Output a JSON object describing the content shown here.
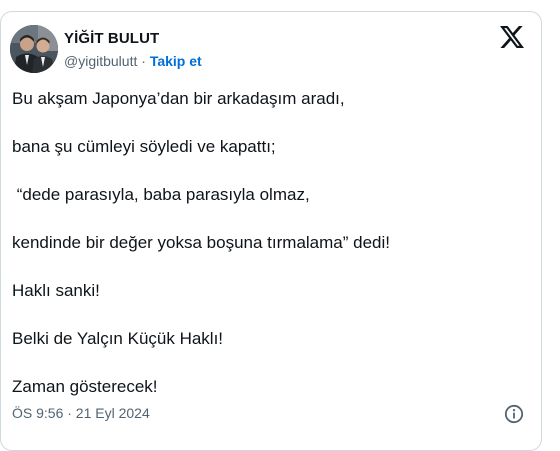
{
  "tweet": {
    "author": {
      "name": "YİĞİT BULUT",
      "handle": "@yigitbulutt",
      "separator": "·",
      "follow_label": "Takip et",
      "avatar_icon": "profile-photo"
    },
    "platform_icon": "x-logo-icon",
    "lines": [
      "Bu akşam Japonya’dan bir arkadaşım aradı,",
      "bana şu cümleyi söyledi ve kapattı;",
      " “dede parasıyla, baba parasıyla olmaz,",
      "kendinde bir değer yoksa boşuna tırmalama” dedi!",
      "Haklı sanki!",
      "Belki de Yalçın Küçük Haklı!",
      "Zaman gösterecek!"
    ],
    "timestamp": "ÖS 9:56 · 21 Eyl 2024",
    "info_icon": "info-circle-icon"
  },
  "colors": {
    "text": "#0f1419",
    "secondary": "#536471",
    "link": "#006fd6",
    "border": "#cfd9de"
  }
}
